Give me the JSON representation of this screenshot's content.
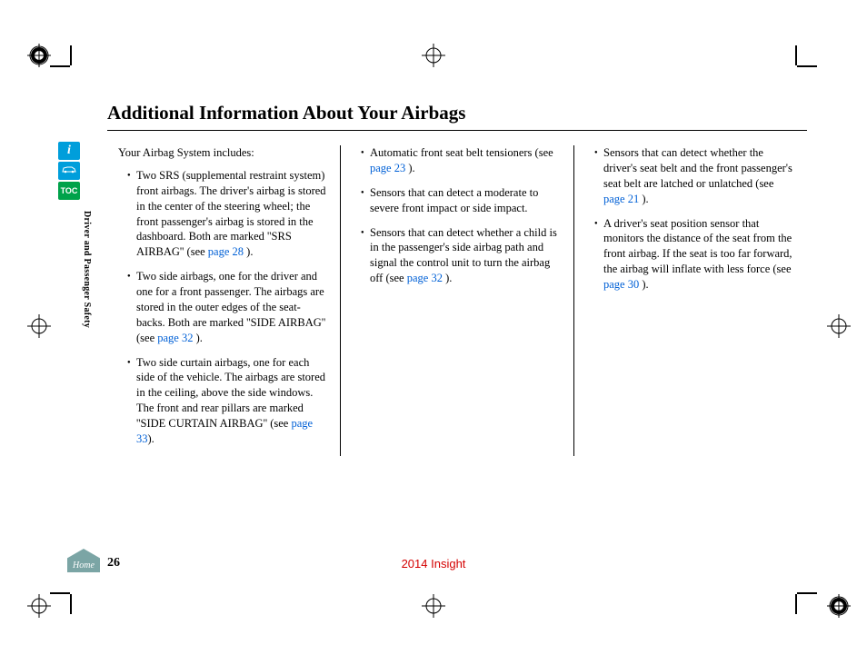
{
  "title": "Additional Information About Your Airbags",
  "sidebar": {
    "info_label": "i",
    "toc_label": "TOC",
    "section_label": "Driver and Passenger Safety",
    "home_label": "Home"
  },
  "content": {
    "intro": "Your Airbag System includes:",
    "col1": [
      {
        "text_parts": [
          "Two SRS (supplemental restraint system) front airbags. The driver's airbag is stored in the center of the steering wheel; the front passenger's airbag is stored in the dashboard. Both are marked ''SRS AIRBAG'' (see ",
          "page 28",
          " )."
        ]
      },
      {
        "text_parts": [
          "Two side airbags, one for the driver and one for a front passenger. The airbags are stored in the outer edges of the seat-backs. Both are marked ''SIDE AIRBAG'' (see ",
          "page 32",
          " )."
        ]
      },
      {
        "text_parts": [
          "Two side curtain airbags, one for each side of the vehicle. The airbags are stored in the ceiling, above the side windows. The front and rear pillars are marked ''SIDE CURTAIN AIRBAG'' (see ",
          "page 33",
          ")."
        ]
      }
    ],
    "col2": [
      {
        "text_parts": [
          "Automatic front seat belt tensioners (see ",
          "page 23",
          " )."
        ]
      },
      {
        "text_parts": [
          "Sensors that can detect a moderate to severe front impact or side impact."
        ]
      },
      {
        "text_parts": [
          "Sensors that can detect whether a child is in the passenger's side airbag path and signal the control unit to turn the airbag off (see ",
          "page 32",
          " )."
        ]
      }
    ],
    "col3": [
      {
        "text_parts": [
          "Sensors that can detect whether the driver's seat belt and the front passenger's seat belt are latched or unlatched (see ",
          "page 21",
          " )."
        ]
      },
      {
        "text_parts": [
          "A driver's seat position sensor that monitors the distance of the seat from the front airbag. If the seat is too far forward, the airbag will inflate with less force (see ",
          "page 30",
          " )."
        ]
      }
    ]
  },
  "footer": {
    "page_number": "26",
    "model": "2014 Insight"
  }
}
